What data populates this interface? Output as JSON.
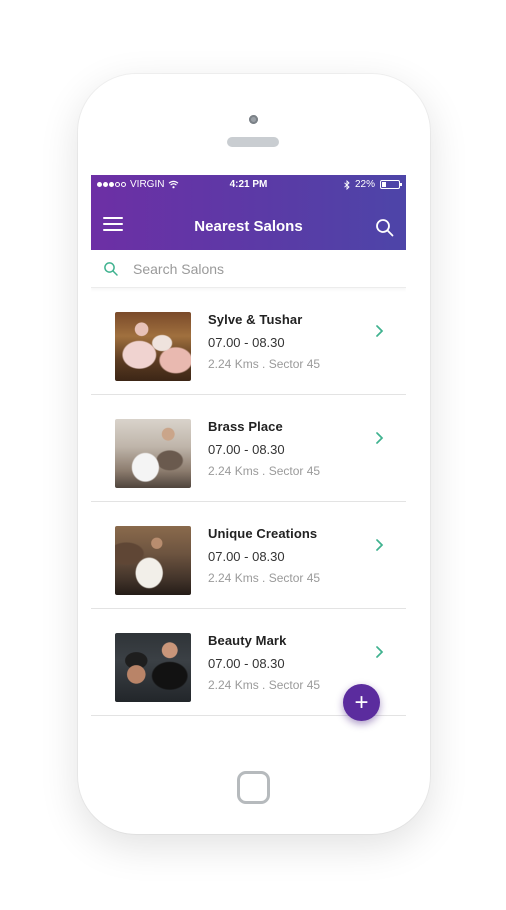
{
  "status_bar": {
    "carrier": "VIRGIN",
    "time": "4:21 PM",
    "battery": "22%",
    "battery_level": 0.22,
    "icons": [
      "signal-dots-icon",
      "wifi-icon",
      "bluetooth-icon",
      "battery-icon"
    ]
  },
  "header": {
    "title": "Nearest Salons",
    "menu_icon": "hamburger-menu-icon",
    "search_icon": "search-icon"
  },
  "search": {
    "placeholder": "Search Salons",
    "value": ""
  },
  "salons": [
    {
      "name": "Sylve & Tushar",
      "hours": "07.00 - 08.30",
      "distance": "2.24 Kms . Sector 45"
    },
    {
      "name": "Brass Place",
      "hours": "07.00 - 08.30",
      "distance": "2.24 Kms . Sector 45"
    },
    {
      "name": "Unique Creations",
      "hours": "07.00 - 08.30",
      "distance": "2.24 Kms . Sector 45"
    },
    {
      "name": "Beauty Mark",
      "hours": "07.00 - 08.30",
      "distance": "2.24 Kms . Sector 45"
    }
  ],
  "fab": {
    "label": "+"
  },
  "colors": {
    "header_start": "#6d2fa5",
    "header_end": "#4d45a8",
    "accent_green": "#3fb28f",
    "fab": "#5b2c9e"
  }
}
